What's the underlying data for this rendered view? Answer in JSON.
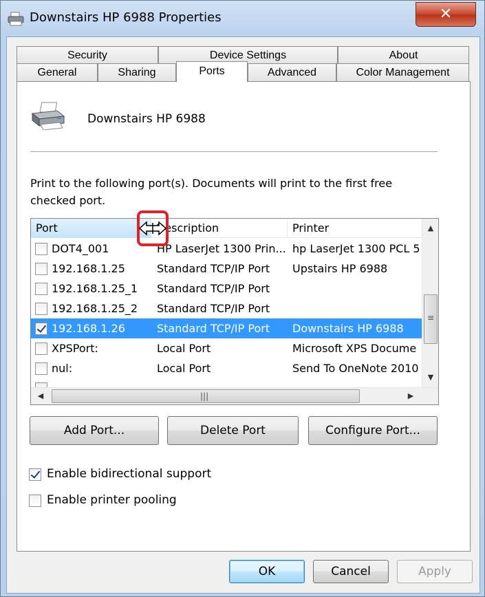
{
  "window": {
    "title": "Downstairs HP 6988 Properties",
    "close_glyph": "✕"
  },
  "tabs_back": [
    {
      "label": "Security"
    },
    {
      "label": "Device Settings"
    },
    {
      "label": "About"
    }
  ],
  "tabs_front": [
    {
      "label": "General"
    },
    {
      "label": "Sharing"
    },
    {
      "label": "Ports"
    },
    {
      "label": "Advanced"
    },
    {
      "label": "Color Management"
    }
  ],
  "active_tab": "Ports",
  "printer": {
    "name": "Downstairs HP 6988"
  },
  "instructions": "Print to the following port(s). Documents will print to the first free checked port.",
  "ports_table": {
    "columns": [
      "Port",
      "Description",
      "Printer"
    ],
    "rows": [
      {
        "port": "DOT4_001",
        "description": "HP LaserJet 1300 Prin...",
        "printer": "hp LaserJet 1300 PCL 5",
        "checked": false,
        "selected": false
      },
      {
        "port": "192.168.1.25",
        "description": "Standard TCP/IP Port",
        "printer": "Upstairs HP 6988",
        "checked": false,
        "selected": false
      },
      {
        "port": "192.168.1.25_1",
        "description": "Standard TCP/IP Port",
        "printer": "",
        "checked": false,
        "selected": false
      },
      {
        "port": "192.168.1.25_2",
        "description": "Standard TCP/IP Port",
        "printer": "",
        "checked": false,
        "selected": false
      },
      {
        "port": "192.168.1.26",
        "description": "Standard TCP/IP Port",
        "printer": "Downstairs HP 6988",
        "checked": true,
        "selected": true
      },
      {
        "port": "XPSPort:",
        "description": "Local Port",
        "printer": "Microsoft XPS Docume",
        "checked": false,
        "selected": false
      },
      {
        "port": "nul:",
        "description": "Local Port",
        "printer": "Send To OneNote 2010",
        "checked": false,
        "selected": false
      }
    ]
  },
  "port_buttons": {
    "add": "Add Port...",
    "delete": "Delete Port",
    "configure": "Configure Port..."
  },
  "options": {
    "bidirectional_label": "Enable bidirectional support",
    "bidirectional_checked": true,
    "pooling_label": "Enable printer pooling",
    "pooling_checked": false
  },
  "dialog_buttons": {
    "ok": "OK",
    "cancel": "Cancel",
    "apply": "Apply"
  },
  "colors": {
    "selection": "#3399ff",
    "highlight_annotation": "#e0202a"
  }
}
